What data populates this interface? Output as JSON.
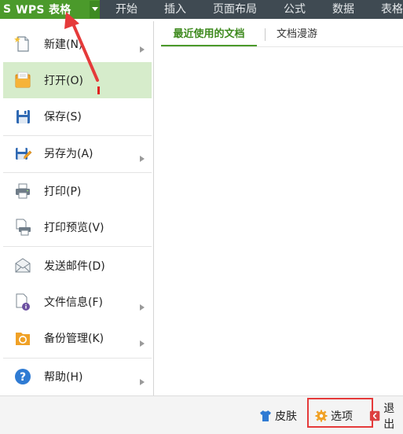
{
  "app": {
    "logo": "S",
    "title": "WPS 表格"
  },
  "menubar": {
    "tabs": [
      "开始",
      "插入",
      "页面布局",
      "公式",
      "数据",
      "表格"
    ]
  },
  "file_menu": {
    "items": [
      {
        "label": "新建(N)",
        "icon": "new-file-icon",
        "has_submenu": true
      },
      {
        "label": "打开(O)",
        "icon": "open-folder-icon",
        "has_submenu": false,
        "active": true
      },
      {
        "label": "保存(S)",
        "icon": "save-icon",
        "has_submenu": false
      },
      {
        "label": "另存为(A)",
        "icon": "save-as-icon",
        "has_submenu": true
      },
      {
        "label": "打印(P)",
        "icon": "print-icon",
        "has_submenu": false
      },
      {
        "label": "打印预览(V)",
        "icon": "print-preview-icon",
        "has_submenu": false
      },
      {
        "label": "发送邮件(D)",
        "icon": "mail-icon",
        "has_submenu": false
      },
      {
        "label": "文件信息(F)",
        "icon": "file-info-icon",
        "has_submenu": true
      },
      {
        "label": "备份管理(K)",
        "icon": "backup-icon",
        "has_submenu": true
      },
      {
        "label": "帮助(H)",
        "icon": "help-icon",
        "has_submenu": true
      }
    ]
  },
  "panel": {
    "tabs": [
      "最近使用的文档",
      "文档漫游"
    ],
    "active_tab": "最近使用的文档"
  },
  "bottom": {
    "skin_label": "皮肤",
    "options_label": "选项",
    "exit_label": "退出"
  },
  "colors": {
    "brand_green": "#4b9a2b",
    "topbar": "#3f4a52",
    "active_row": "#d6eccb",
    "annotation_red": "#e53a3a"
  }
}
